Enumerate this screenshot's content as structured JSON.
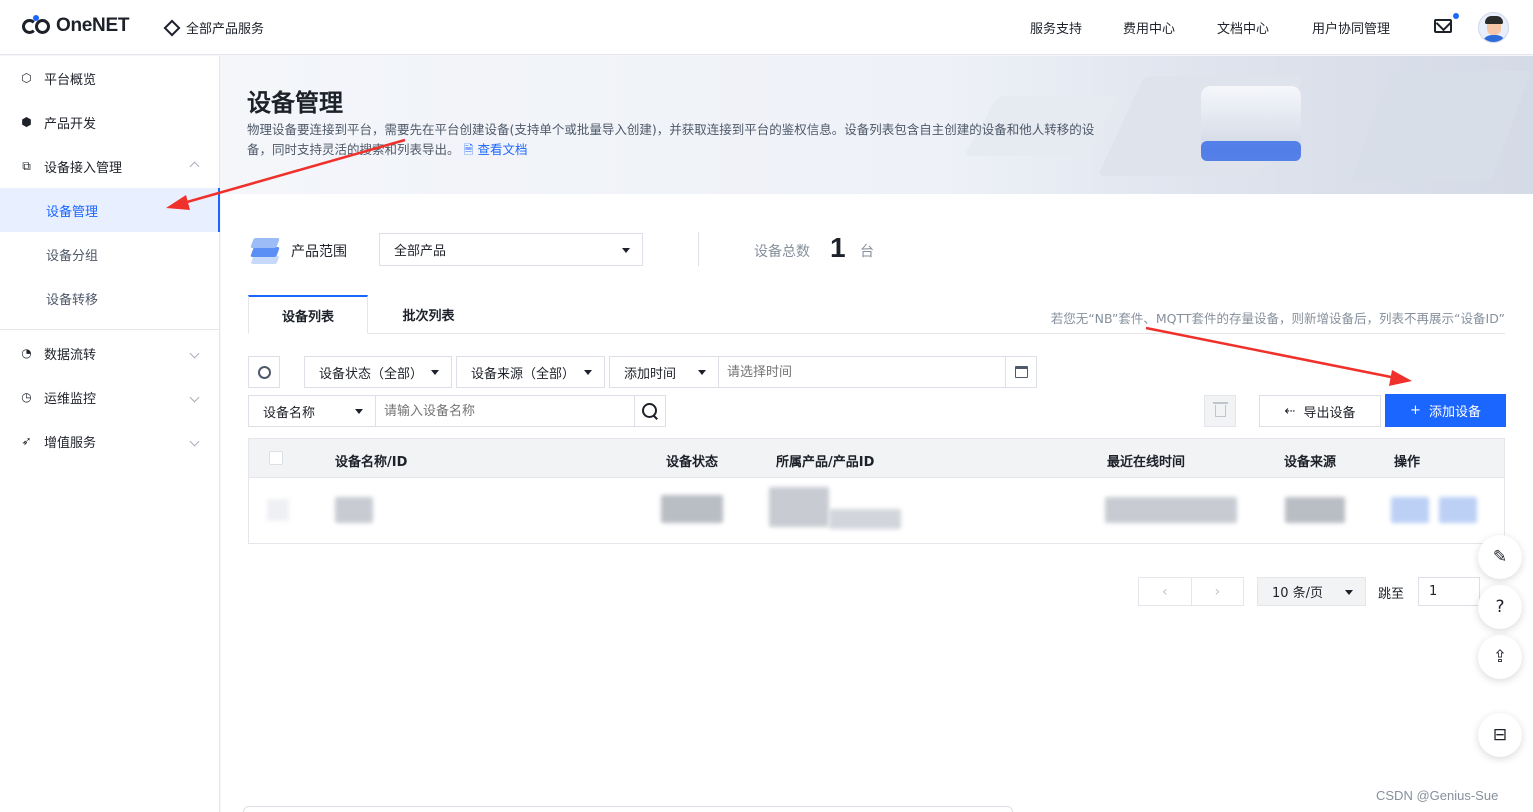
{
  "brand": {
    "name": "OneNET"
  },
  "topbar": {
    "all_products": "全部产品服务",
    "menu": [
      "服务支持",
      "费用中心",
      "文档中心",
      "用户协同管理"
    ]
  },
  "sidebar": {
    "items": [
      {
        "label": "平台概览",
        "icon": "hexagon-icon"
      },
      {
        "label": "产品开发",
        "icon": "cube-icon"
      },
      {
        "label": "设备接入管理",
        "icon": "device-icon",
        "expanded": true
      },
      {
        "label": "设备管理",
        "active": true
      },
      {
        "label": "设备分组"
      },
      {
        "label": "设备转移"
      },
      {
        "label": "数据流转",
        "icon": "flow-icon"
      },
      {
        "label": "运维监控",
        "icon": "monitor-icon"
      },
      {
        "label": "增值服务",
        "icon": "send-icon"
      }
    ]
  },
  "banner": {
    "title": "设备管理",
    "desc": "物理设备要连接到平台，需要先在平台创建设备(支持单个或批量导入创建)，并获取连接到平台的鉴权信息。设备列表包含自主创建的设备和他人转移的设备，同时支持灵活的搜索和列表导出。",
    "doc_link": "查看文档"
  },
  "filter": {
    "product_scope_label": "产品范围",
    "product_scope_value": "全部产品",
    "total_label": "设备总数",
    "total_value": "1",
    "total_unit": "台"
  },
  "tabs": [
    "设备列表",
    "批次列表"
  ],
  "tab_note": "若您无“NB”套件、MQTT套件的存量设备，则新增设备后，列表不再展示“设备ID”",
  "toolbar": {
    "status_select": "设备状态（全部）",
    "source_select": "设备来源（全部）",
    "time_select": "添加时间",
    "time_placeholder": "请选择时间",
    "name_select": "设备名称",
    "name_placeholder": "请输入设备名称",
    "export_label": "导出设备",
    "add_label": "添加设备"
  },
  "table": {
    "columns": [
      "设备名称/ID",
      "设备状态",
      "所属产品/产品ID",
      "最近在线时间",
      "设备来源",
      "操作"
    ]
  },
  "pagination": {
    "page_size": "10 条/页",
    "jump_label": "跳至",
    "jump_value": "1"
  },
  "watermark": "CSDN @Genius-Sue",
  "colors": {
    "accent": "#1a66ff",
    "annotation_arrow": "#f0302a"
  }
}
